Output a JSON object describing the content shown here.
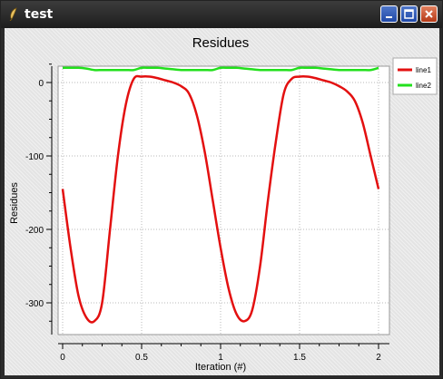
{
  "window": {
    "title": "test",
    "title_icon": "feather-icon",
    "buttons": {
      "minimize": "minimize-icon",
      "maximize": "maximize-icon",
      "close": "close-icon"
    }
  },
  "chart_data": {
    "type": "line",
    "title": "Residues",
    "xlabel": "Iteration (#)",
    "ylabel": "Residues",
    "xlim": [
      0,
      2
    ],
    "ylim": [
      -330,
      25
    ],
    "x_ticks": [
      0,
      0.5,
      1,
      1.5,
      2
    ],
    "x_tick_labels": [
      "0",
      "0.5",
      "1",
      "1.5",
      "2"
    ],
    "y_ticks": [
      0,
      -100,
      -200,
      -300
    ],
    "y_tick_labels": [
      "0",
      "-100",
      "-200",
      "-300"
    ],
    "grid": true,
    "legend": "top-right",
    "series": [
      {
        "name": "line1",
        "color": "#e31010",
        "x": [
          0,
          0.05,
          0.1,
          0.15,
          0.2,
          0.25,
          0.3,
          0.35,
          0.4,
          0.45,
          0.5,
          0.55,
          0.6,
          0.65,
          0.7,
          0.75,
          0.8,
          0.85,
          0.9,
          0.95,
          1.0,
          1.05,
          1.1,
          1.15,
          1.2,
          1.25,
          1.3,
          1.35,
          1.4,
          1.45,
          1.5,
          1.55,
          1.6,
          1.65,
          1.7,
          1.75,
          1.8,
          1.85,
          1.9,
          1.95,
          2.0
        ],
        "y": [
          -145,
          -225,
          -290,
          -320,
          -325,
          -300,
          -200,
          -100,
          -30,
          5,
          8,
          8,
          6,
          3,
          0,
          -5,
          -15,
          -45,
          -95,
          -160,
          -225,
          -280,
          -315,
          -325,
          -310,
          -250,
          -160,
          -80,
          -15,
          5,
          8,
          8,
          6,
          3,
          0,
          -5,
          -12,
          -25,
          -55,
          -100,
          -145
        ]
      },
      {
        "name": "line2",
        "color": "#22e01c",
        "x": [
          0,
          0.05,
          0.1,
          0.15,
          0.2,
          0.25,
          0.3,
          0.35,
          0.4,
          0.45,
          0.5,
          0.55,
          0.6,
          0.65,
          0.7,
          0.75,
          0.8,
          0.85,
          0.9,
          0.95,
          1.0,
          1.05,
          1.1,
          1.15,
          1.2,
          1.25,
          1.3,
          1.35,
          1.4,
          1.45,
          1.5,
          1.55,
          1.6,
          1.65,
          1.7,
          1.75,
          1.8,
          1.85,
          1.9,
          1.95,
          2.0
        ],
        "y": [
          20,
          20,
          20,
          19,
          17,
          17,
          17,
          17,
          17,
          17,
          20,
          20,
          20,
          19,
          18,
          17,
          17,
          17,
          17,
          17,
          20,
          20,
          20,
          19,
          18,
          17,
          17,
          17,
          17,
          17,
          20,
          20,
          20,
          19,
          18,
          17,
          17,
          17,
          17,
          17,
          20
        ]
      }
    ]
  }
}
